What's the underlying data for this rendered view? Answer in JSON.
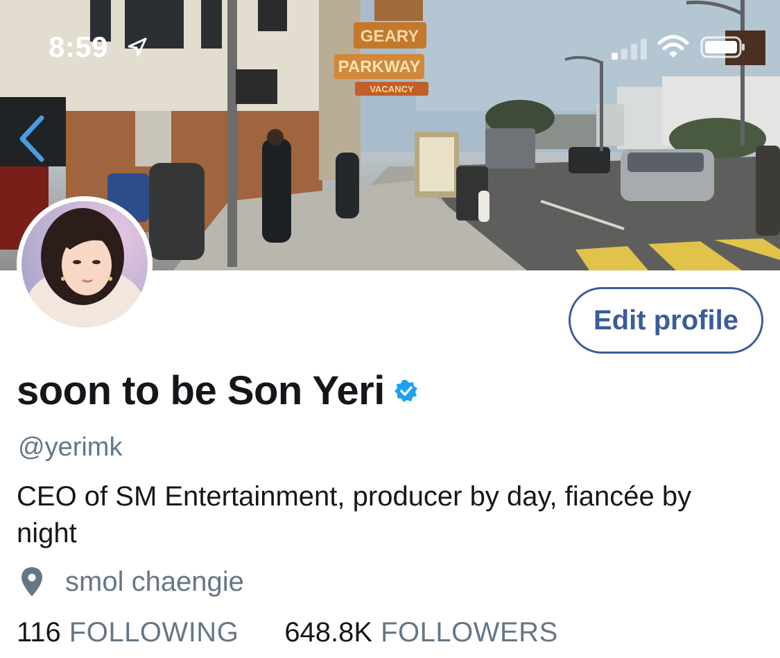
{
  "status_bar": {
    "time": "8:59",
    "icons": [
      "location-arrow-icon",
      "cellular-signal-icon",
      "wifi-icon",
      "battery-icon"
    ]
  },
  "header": {
    "back_icon": "chevron-left-icon",
    "banner_signs": {
      "street": "GEARY",
      "road": "PARKWAY",
      "motel": "VACANCY"
    }
  },
  "profile": {
    "edit_button": "Edit profile",
    "display_name": "soon to be Son Yeri",
    "verified_icon": "verified-badge-icon",
    "handle": "@yerimk",
    "bio": "CEO of SM Entertainment, producer by day, fiancée by night",
    "location_icon": "map-pin-icon",
    "location": "smol chaengie",
    "following": {
      "count": "116",
      "label": "FOLLOWING"
    },
    "followers": {
      "count": "648.8K",
      "label": "FOLLOWERS"
    }
  },
  "colors": {
    "accent": "#3b5c9a",
    "verified": "#1da1f2",
    "secondary_text": "#657786",
    "primary_text": "#14171a"
  }
}
